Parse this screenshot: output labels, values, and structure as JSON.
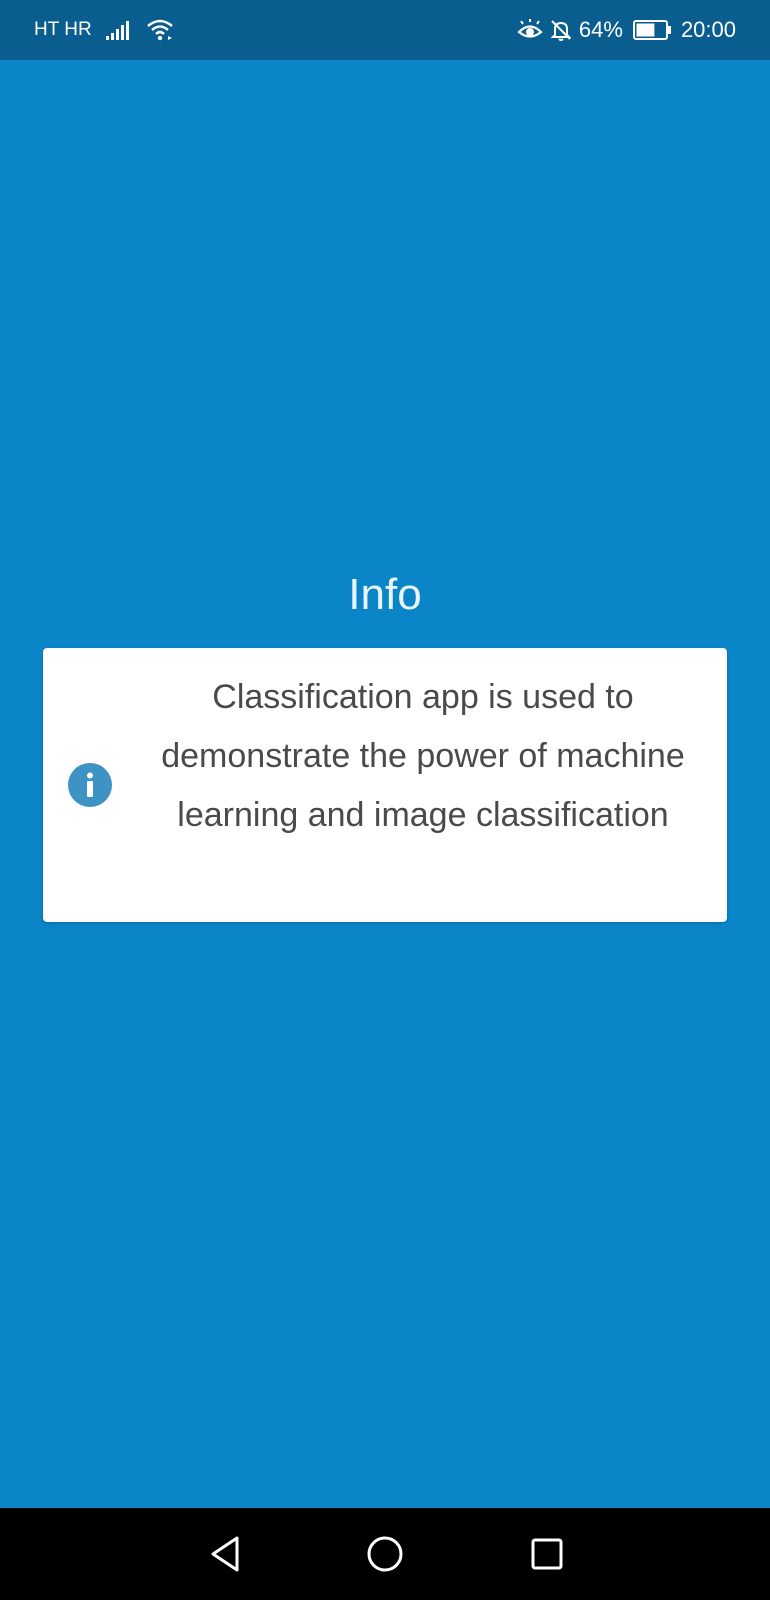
{
  "status_bar": {
    "carrier": "HT HR",
    "battery_percent": "64%",
    "battery_level": 0.64,
    "time": "20:00",
    "icons": [
      "signal-icon",
      "wifi-icon",
      "eye-comfort-icon",
      "notifications-off-icon",
      "battery-icon"
    ]
  },
  "main": {
    "title": "Info",
    "card": {
      "icon": "info-icon",
      "text": "Classification app is used to demonstrate the power of machine learning and image classification"
    }
  },
  "nav_bar": {
    "icons": [
      "back-icon",
      "home-icon",
      "recents-icon"
    ]
  },
  "colors": {
    "background": "#0a85c7",
    "status_bar": "#0a5e8f",
    "card": "#ffffff",
    "info_icon": "#3c93c4",
    "text": "#4a4a4a",
    "nav_bar": "#000000"
  }
}
